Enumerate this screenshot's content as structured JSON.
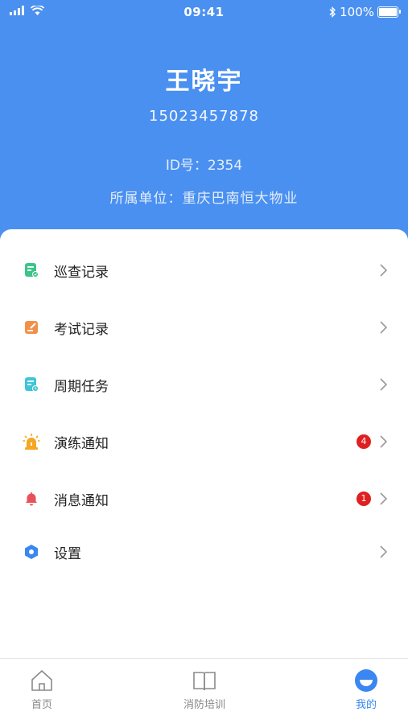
{
  "status_bar": {
    "time": "09:41",
    "battery": "100%"
  },
  "profile": {
    "name": "王晓宇",
    "phone": "15023457878",
    "id_label": "ID号：2354",
    "unit_label": "所属单位：重庆巴南恒大物业"
  },
  "menu": [
    {
      "label": "巡查记录",
      "icon": "patrol-record-icon",
      "badge": ""
    },
    {
      "label": "考试记录",
      "icon": "exam-record-icon",
      "badge": ""
    },
    {
      "label": "周期任务",
      "icon": "periodic-task-icon",
      "badge": ""
    },
    {
      "label": "演练通知",
      "icon": "alarm-light-icon",
      "badge": "4"
    },
    {
      "label": "消息通知",
      "icon": "bell-icon",
      "badge": "1"
    },
    {
      "label": "设置",
      "icon": "settings-icon",
      "badge": ""
    }
  ],
  "tabs": [
    {
      "label": "首页",
      "icon": "home-icon"
    },
    {
      "label": "消防培训",
      "icon": "book-icon"
    },
    {
      "label": "我的",
      "icon": "profile-icon"
    }
  ],
  "colors": {
    "header_bg": "#4a90f0",
    "accent": "#3a86f2",
    "badge": "#e02020"
  }
}
